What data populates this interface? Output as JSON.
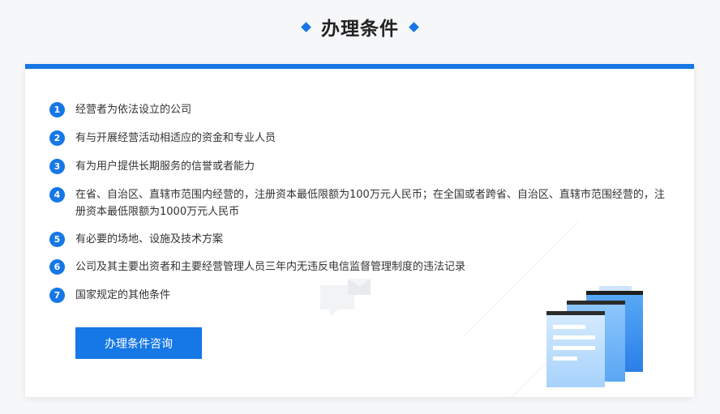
{
  "header": {
    "title": "办理条件"
  },
  "conditions": [
    {
      "num": "1",
      "text": "经营者为依法设立的公司"
    },
    {
      "num": "2",
      "text": "有与开展经营活动相适应的资金和专业人员"
    },
    {
      "num": "3",
      "text": "有为用户提供长期服务的信誉或者能力"
    },
    {
      "num": "4",
      "text": "在省、自治区、直辖市范围内经营的，注册资本最低限额为100万元人民币；在全国或者跨省、自治区、直辖市范围经营的，注册资本最低限额为1000万元人民币"
    },
    {
      "num": "5",
      "text": "有必要的场地、设施及技术方案"
    },
    {
      "num": "6",
      "text": "公司及其主要出资者和主要经营管理人员三年内无违反电信监督管理制度的违法记录"
    },
    {
      "num": "7",
      "text": "国家规定的其他条件"
    }
  ],
  "consult_button": {
    "label": "办理条件咨询"
  },
  "colors": {
    "accent": "#1677e6"
  },
  "icons": [
    "diamond-icon",
    "chat-bubble-icon",
    "document-stack-icon"
  ]
}
